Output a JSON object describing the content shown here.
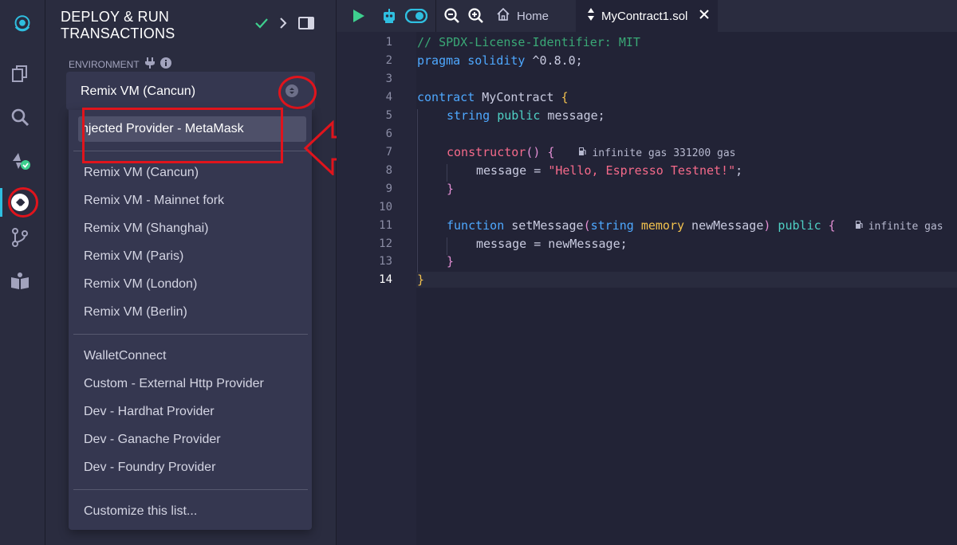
{
  "panel": {
    "title": "DEPLOY & RUN TRANSACTIONS",
    "environment_label": "ENVIRONMENT",
    "selected_environment": "Remix VM (Cancun)",
    "highlighted_option": "njected Provider - MetaMask",
    "vm_options": [
      "Remix VM (Cancun)",
      "Remix VM - Mainnet fork",
      "Remix VM (Shanghai)",
      "Remix VM (Paris)",
      "Remix VM (London)",
      "Remix VM (Berlin)"
    ],
    "provider_options": [
      "WalletConnect",
      "Custom - External Http Provider",
      "Dev - Hardhat Provider",
      "Dev - Ganache Provider",
      "Dev - Foundry Provider"
    ],
    "customize": "Customize this list..."
  },
  "editor": {
    "home_tab": "Home",
    "file_tab": "MyContract1.sol",
    "line_numbers": [
      "1",
      "2",
      "3",
      "4",
      "5",
      "6",
      "7",
      "8",
      "9",
      "10",
      "11",
      "12",
      "13",
      "14"
    ],
    "code": {
      "l1": "// SPDX-License-Identifier: MIT",
      "l2_kw": "pragma solidity",
      "l2_rest": " ^0.8.0;",
      "l4_kw": "contract",
      "l4_name": " MyContract ",
      "l4_brace": "{",
      "l5_type": "string",
      "l5_mod": " public",
      "l5_rest": " message;",
      "l7_fn": "constructor",
      "l7_paren": "() ",
      "l7_brace": "{",
      "l7_hint": "infinite gas 331200 gas",
      "l8_var": "message = ",
      "l8_str": "\"Hello, Espresso Testnet!\"",
      "l8_end": ";",
      "l9_brace": "}",
      "l11_kw": "function",
      "l11_name": " setMessage",
      "l11_paren1": "(",
      "l11_type": "string",
      "l11_mem": " memory",
      "l11_param": " newMessage",
      "l11_paren2": ")",
      "l11_pub": " public ",
      "l11_brace": "{",
      "l11_hint": "infinite gas",
      "l12": "message = newMessage;",
      "l13_brace": "}",
      "l14_brace": "}"
    }
  },
  "colors": {
    "accent": "#2fbfe0",
    "annotation_red": "#e0141c",
    "run_green": "#3ecf8e"
  }
}
